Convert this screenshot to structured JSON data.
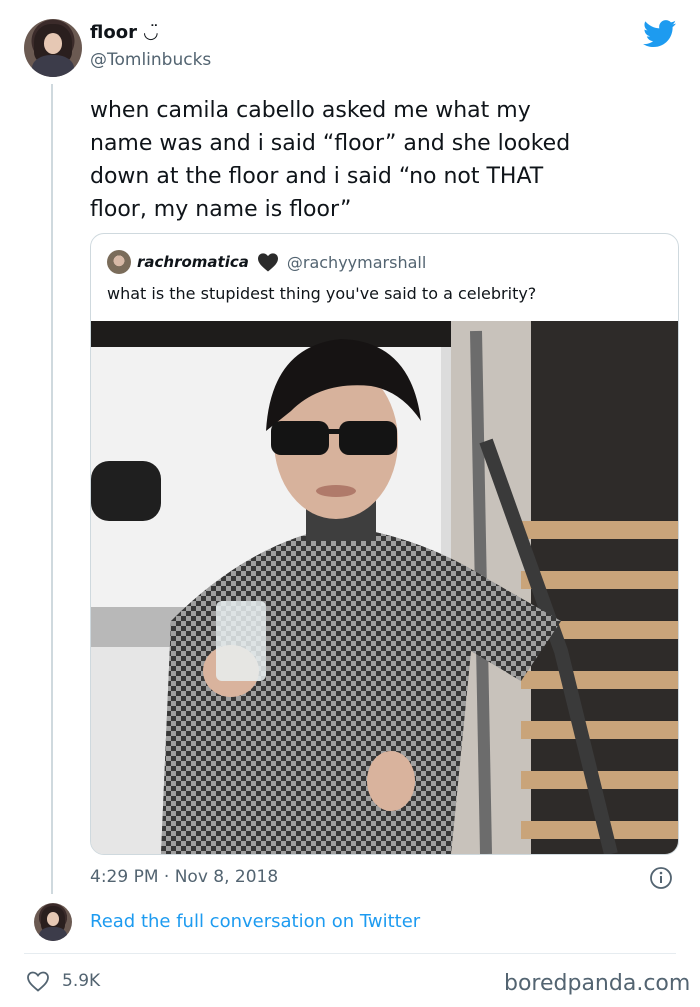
{
  "author": {
    "name": "floor",
    "handle": "@Tomlinbucks",
    "emoji": "◡̈"
  },
  "tweet": {
    "text": "when camila cabello asked me what my\nname was and i said “floor” and she looked\ndown at the floor and i said “no not THAT\nfloor, my name is floor”",
    "timestamp": "4:29 PM · Nov 8, 2018",
    "likes": "5.9K"
  },
  "quoted": {
    "name": "rachromatica",
    "handle": "@rachyymarshall",
    "text": "what is the stupidest thing you've said to a celebrity?"
  },
  "conversation_link": "Read the full conversation on Twitter",
  "watermark": "boredpanda.com",
  "colors": {
    "twitter_blue": "#1d9bf0",
    "secondary_text": "#536471"
  },
  "icons": [
    "twitter-bird-icon",
    "info-icon",
    "heart-icon",
    "black-heart-icon"
  ]
}
